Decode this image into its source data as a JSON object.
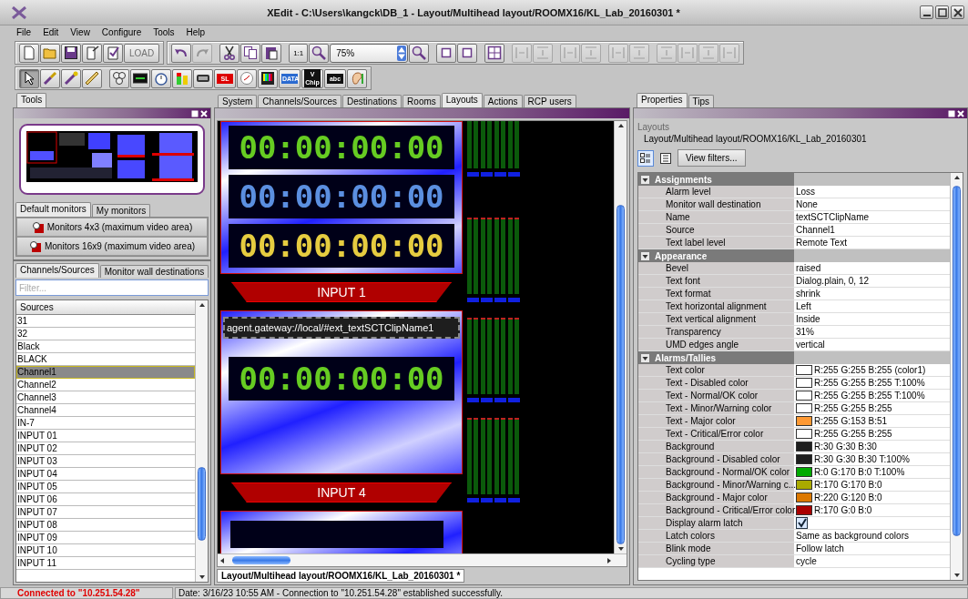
{
  "window": {
    "title": "XEdit - C:\\Users\\kangck\\DB_1 - Layout/Multihead layout/ROOMX16/KL_Lab_20160301 *"
  },
  "menu": [
    "File",
    "Edit",
    "View",
    "Configure",
    "Tools",
    "Help"
  ],
  "toolbar_1": [
    [
      {
        "kind": "new",
        "disabled": false
      },
      {
        "kind": "open",
        "disabled": false
      },
      {
        "kind": "save",
        "disabled": false
      },
      {
        "kind": "export",
        "disabled": false
      },
      {
        "kind": "check",
        "disabled": false
      },
      {
        "kind": "load",
        "label": "LOAD",
        "disabled": true
      }
    ],
    [
      {
        "kind": "undo",
        "disabled": false
      },
      {
        "kind": "redo",
        "disabled": true
      }
    ],
    [
      {
        "kind": "cut",
        "disabled": false
      },
      {
        "kind": "copy",
        "disabled": false
      },
      {
        "kind": "paste",
        "disabled": false
      }
    ],
    [
      {
        "kind": "fit",
        "label": "1:1",
        "disabled": false
      },
      {
        "kind": "zoom-out",
        "disabled": false
      },
      {
        "kind": "combo",
        "label": "75%",
        "disabled": false
      },
      {
        "kind": "zoom-in",
        "disabled": false
      }
    ],
    [
      {
        "kind": "frame",
        "disabled": false
      },
      {
        "kind": "frame",
        "disabled": false
      }
    ],
    [
      {
        "kind": "grid",
        "disabled": false
      }
    ],
    [
      {
        "kind": "align-h",
        "disabled": true
      },
      {
        "kind": "align-v",
        "disabled": true
      }
    ],
    [
      {
        "kind": "align-h",
        "disabled": true
      },
      {
        "kind": "align-v",
        "disabled": true
      }
    ],
    [
      {
        "kind": "align-h",
        "disabled": true
      },
      {
        "kind": "align-v",
        "disabled": true
      }
    ],
    [
      {
        "kind": "align-v",
        "disabled": true
      },
      {
        "kind": "align-h",
        "disabled": true
      },
      {
        "kind": "align-v",
        "disabled": true
      },
      {
        "kind": "align-h",
        "disabled": true
      }
    ]
  ],
  "toolbar_2": [
    [
      {
        "kind": "pointer",
        "selected": true
      },
      {
        "kind": "brush",
        "selected": false
      },
      {
        "kind": "wand",
        "selected": false
      },
      {
        "kind": "ruler",
        "selected": false
      }
    ],
    [
      {
        "kind": "reels",
        "selected": false
      },
      {
        "kind": "meter",
        "selected": false
      },
      {
        "kind": "clock",
        "selected": false
      },
      {
        "kind": "levels",
        "selected": false
      },
      {
        "kind": "umd",
        "selected": false
      },
      {
        "kind": "tag",
        "label": "SL",
        "selected": false
      },
      {
        "kind": "analog",
        "selected": false
      },
      {
        "kind": "bars",
        "selected": false
      },
      {
        "kind": "tag",
        "label": "DATA",
        "selected": false
      },
      {
        "kind": "tag",
        "label": "V Chip",
        "selected": false
      },
      {
        "kind": "tag",
        "label": "abc",
        "selected": false
      },
      {
        "kind": "ear",
        "selected": false
      }
    ]
  ],
  "left_panel": {
    "tab": {
      "label": "Tools",
      "selected": true
    },
    "monitor_tabs": [
      {
        "label": "Default monitors",
        "selected": true
      },
      {
        "label": "My monitors",
        "selected": false
      }
    ],
    "monitor_buttons": [
      "Monitors 4x3 (maximum video area)",
      "Monitors 16x9 (maximum video area)"
    ],
    "source_tabs": [
      {
        "label": "Channels/Sources",
        "selected": true
      },
      {
        "label": "Monitor wall destinations",
        "selected": false
      }
    ],
    "filter": {
      "placeholder": "Filter..."
    },
    "list_header": "Sources",
    "sources": [
      {
        "label": "31",
        "selected": false
      },
      {
        "label": "32",
        "selected": false
      },
      {
        "label": "Black",
        "selected": false
      },
      {
        "label": "BLACK",
        "selected": false
      },
      {
        "label": "Channel1",
        "selected": true
      },
      {
        "label": "Channel2",
        "selected": false
      },
      {
        "label": "Channel3",
        "selected": false
      },
      {
        "label": "Channel4",
        "selected": false
      },
      {
        "label": "IN-7",
        "selected": false
      },
      {
        "label": "INPUT 01",
        "selected": false
      },
      {
        "label": "INPUT 02",
        "selected": false
      },
      {
        "label": "INPUT 03",
        "selected": false
      },
      {
        "label": "INPUT 04",
        "selected": false
      },
      {
        "label": "INPUT 05",
        "selected": false
      },
      {
        "label": "INPUT 06",
        "selected": false
      },
      {
        "label": "INPUT 07",
        "selected": false
      },
      {
        "label": "INPUT 08",
        "selected": false
      },
      {
        "label": "INPUT 09",
        "selected": false
      },
      {
        "label": "INPUT 10",
        "selected": false
      },
      {
        "label": "INPUT 11",
        "selected": false
      }
    ]
  },
  "center_tabs": [
    {
      "label": "System",
      "selected": false
    },
    {
      "label": "Channels/Sources",
      "selected": false
    },
    {
      "label": "Destinations",
      "selected": false
    },
    {
      "label": "Rooms",
      "selected": false
    },
    {
      "label": "Layouts",
      "selected": true
    },
    {
      "label": "Actions",
      "selected": false
    },
    {
      "label": "RCP users",
      "selected": false
    }
  ],
  "canvas": {
    "tiles": [
      {
        "timecodes": [
          {
            "text": "00:00:00:00",
            "color": "#66cc22"
          },
          {
            "text": "00:00:00:00",
            "color": "#5b8fe0"
          },
          {
            "text": "00:00:00:00",
            "color": "#e6cc40"
          }
        ],
        "label": "INPUT 1"
      },
      {
        "clip_name": "agent.gateway://local/#ext_textSCTClipName1",
        "timecodes": [
          {
            "text": "00:00:00:00",
            "color": "#66cc22"
          }
        ],
        "label": "INPUT 4"
      }
    ]
  },
  "document_tab": {
    "label": "Layout/Multihead layout/ROOMX16/KL_Lab_20160301 *",
    "selected": true
  },
  "right_panel": {
    "tabs": [
      {
        "label": "Properties",
        "selected": true
      },
      {
        "label": "Tips",
        "selected": false
      }
    ],
    "category": "Layouts",
    "path": "Layout/Multihead layout/ROOMX16/KL_Lab_20160301",
    "view_modes": [
      {
        "kind": "categorized",
        "selected": true
      },
      {
        "kind": "list",
        "selected": false
      }
    ],
    "view_filters": "View filters...",
    "sections": [
      {
        "title": "Assignments",
        "expanded": true,
        "rows": [
          {
            "kind": "text",
            "label": "Alarm level",
            "value": "Loss"
          },
          {
            "kind": "text",
            "label": "Monitor wall destination",
            "value": "None"
          },
          {
            "kind": "text",
            "label": "Name",
            "value": "textSCTClipName"
          },
          {
            "kind": "text",
            "label": "Source",
            "value": "Channel1"
          },
          {
            "kind": "text",
            "label": "Text label level",
            "value": "Remote Text"
          }
        ]
      },
      {
        "title": "Appearance",
        "expanded": true,
        "rows": [
          {
            "kind": "text",
            "label": "Bevel",
            "value": "raised"
          },
          {
            "kind": "text",
            "label": "Text font",
            "value": "Dialog.plain, 0, 12"
          },
          {
            "kind": "text",
            "label": "Text format",
            "value": "shrink"
          },
          {
            "kind": "text",
            "label": "Text horizontal alignment",
            "value": "Left"
          },
          {
            "kind": "text",
            "label": "Text vertical alignment",
            "value": "Inside"
          },
          {
            "kind": "text",
            "label": "Transparency",
            "value": "31%"
          },
          {
            "kind": "text",
            "label": "UMD edges angle",
            "value": "vertical"
          }
        ]
      },
      {
        "title": "Alarms/Tallies",
        "expanded": true,
        "rows": [
          {
            "kind": "color",
            "label": "Text color",
            "color": "#ffffff",
            "value": "R:255 G:255 B:255 (color1)"
          },
          {
            "kind": "color",
            "label": "Text - Disabled color",
            "color": "#ffffff",
            "value": "R:255 G:255 B:255 T:100%"
          },
          {
            "kind": "color",
            "label": "Text - Normal/OK color",
            "color": "#ffffff",
            "value": "R:255 G:255 B:255 T:100%"
          },
          {
            "kind": "color",
            "label": "Text - Minor/Warning color",
            "color": "#ffffff",
            "value": "R:255 G:255 B:255"
          },
          {
            "kind": "color",
            "label": "Text - Major color",
            "color": "#ff9933",
            "value": "R:255 G:153 B:51"
          },
          {
            "kind": "color",
            "label": "Text - Critical/Error color",
            "color": "#ffffff",
            "value": "R:255 G:255 B:255"
          },
          {
            "kind": "color",
            "label": "Background",
            "color": "#1e1e1e",
            "value": "R:30 G:30 B:30"
          },
          {
            "kind": "color",
            "label": "Background - Disabled color",
            "color": "#1e1e1e",
            "value": "R:30 G:30 B:30 T:100%"
          },
          {
            "kind": "color",
            "label": "Background - Normal/OK color",
            "color": "#00aa00",
            "value": "R:0 G:170 B:0 T:100%"
          },
          {
            "kind": "color",
            "label": "Background - Minor/Warning c...",
            "color": "#aaaa00",
            "value": "R:170 G:170 B:0"
          },
          {
            "kind": "color",
            "label": "Background - Major color",
            "color": "#dc7800",
            "value": "R:220 G:120 B:0"
          },
          {
            "kind": "color",
            "label": "Background - Critical/Error color",
            "color": "#aa0000",
            "value": "R:170 G:0 B:0"
          },
          {
            "kind": "check",
            "label": "Display alarm latch",
            "checked": true
          },
          {
            "kind": "text",
            "label": "Latch colors",
            "value": "Same as background colors"
          },
          {
            "kind": "text",
            "label": "Blink mode",
            "value": "Follow latch"
          },
          {
            "kind": "text",
            "label": "Cycling type",
            "value": "cycle"
          }
        ]
      }
    ]
  },
  "status_bar": {
    "connection": "Connected to \"10.251.54.28\"",
    "message": "Date: 3/16/23 10:55 AM - Connection to \"10.251.54.28\" established successfully."
  }
}
